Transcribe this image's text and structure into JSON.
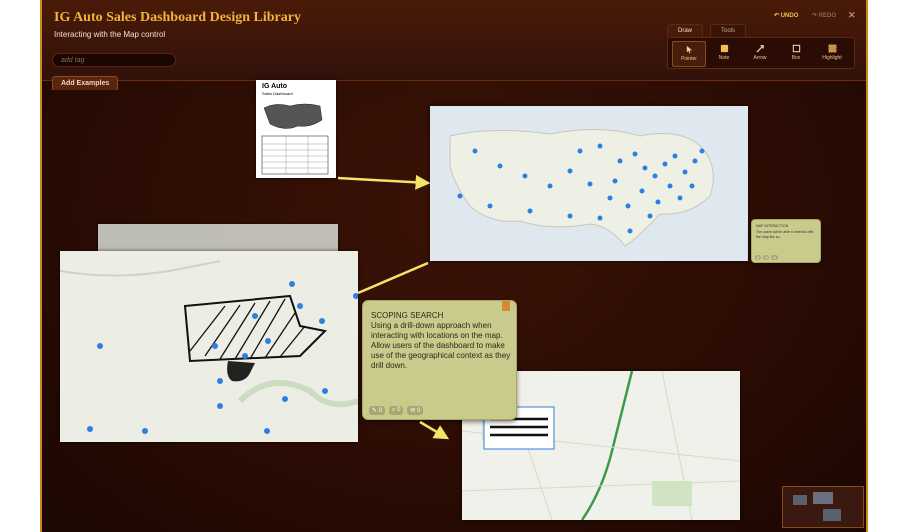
{
  "header": {
    "title": "IG Auto Sales Dashboard Design Library",
    "subtitle": "Interacting with the Map control",
    "tag_placeholder": "add tag",
    "add_examples": "Add Examples",
    "undo": "UNDO",
    "redo": "REDO",
    "close": "✕"
  },
  "toolbar": {
    "tabs": [
      "Draw",
      "Tools"
    ],
    "tools": [
      "Pointer",
      "Note",
      "Arrow",
      "Box",
      "Highlight"
    ]
  },
  "thumb_doc": {
    "title_line1": "IG Auto",
    "title_line2": "Sales Dashboard"
  },
  "note_main": {
    "heading": "SCOPING SEARCH",
    "body": "Using a drill-down approach when interacting with locations on the map. Allow users of the dashboard to make use of the geographical context as they drill down.",
    "stats": [
      "0",
      "0",
      "0"
    ]
  },
  "note_small": {
    "heading": "MAP INTERACTION",
    "body": "The users will be able to interact with the map like so.",
    "stats": [
      "0",
      "0",
      "0"
    ]
  },
  "colors": {
    "accent": "#f3b23b",
    "frame": "#c98a1a",
    "map_dot": "#2f7fe0",
    "arrow": "#f4e46a"
  }
}
